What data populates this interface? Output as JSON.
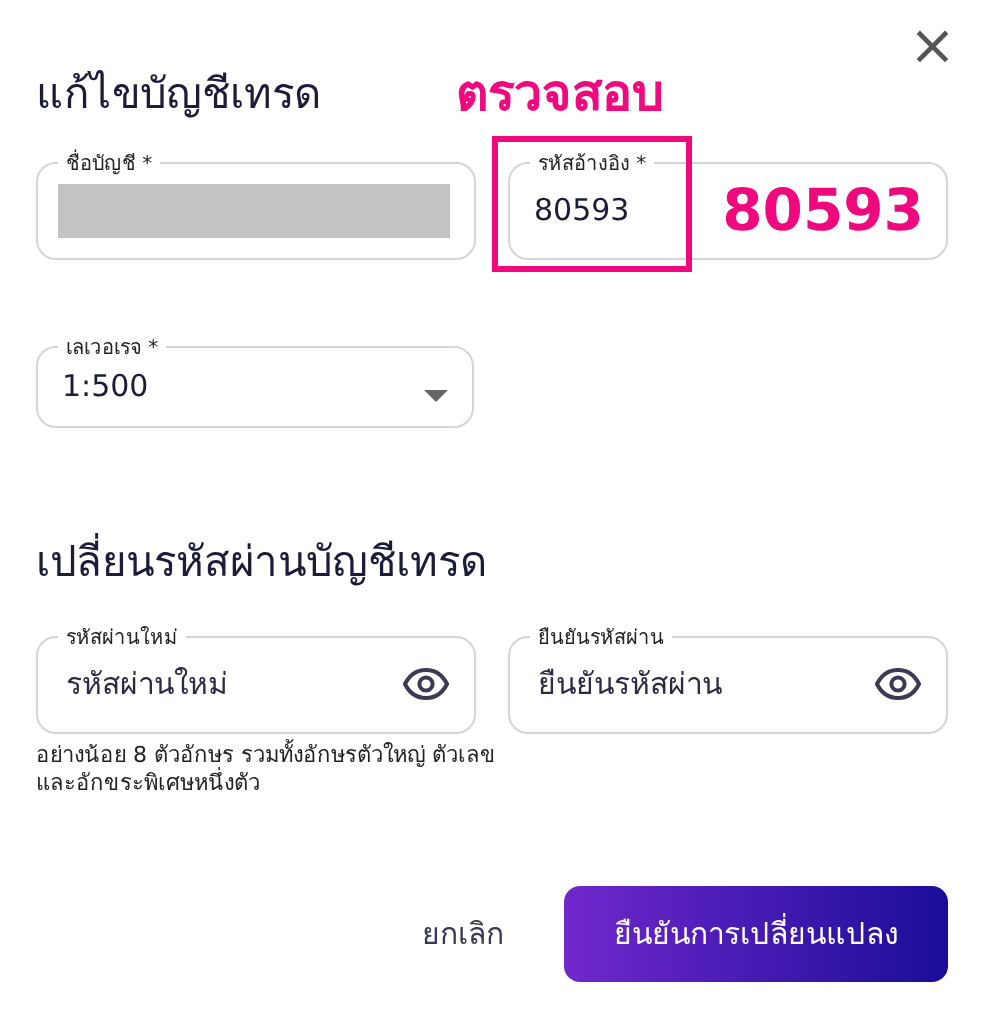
{
  "dialog": {
    "title": "แก้ไขบัญชีเทรด",
    "close": "×"
  },
  "account_fields": [
    {
      "kind": "redacted",
      "label": "ชื่อบัญชี *"
    },
    {
      "kind": "text",
      "label": "รหัสอ้างอิง *",
      "value": "80593",
      "highlighted": true
    }
  ],
  "leverage": {
    "label": "เลเวอเรจ *",
    "value": "1:500"
  },
  "password_section": {
    "title": "เปลี่ยนรหัสผ่านบัญชีเทรด",
    "fields": [
      {
        "label": "รหัสผ่านใหม่",
        "placeholder": "รหัสผ่านใหม่"
      },
      {
        "label": "ยืนยันรหัสผ่าน",
        "placeholder": "ยืนยันรหัสผ่าน"
      }
    ],
    "hint": "อย่างน้อย 8 ตัวอักษร รวมทั้งอักษรตัวใหญ่ ตัวเลข และอักขระพิเศษหนึ่งตัว"
  },
  "annotations": {
    "heading": "ตรวจสอบ",
    "note": "80593"
  },
  "buttons": {
    "cancel": "ยกเลิก",
    "confirm": "ยืนยันการเปลี่ยนแปลง"
  }
}
